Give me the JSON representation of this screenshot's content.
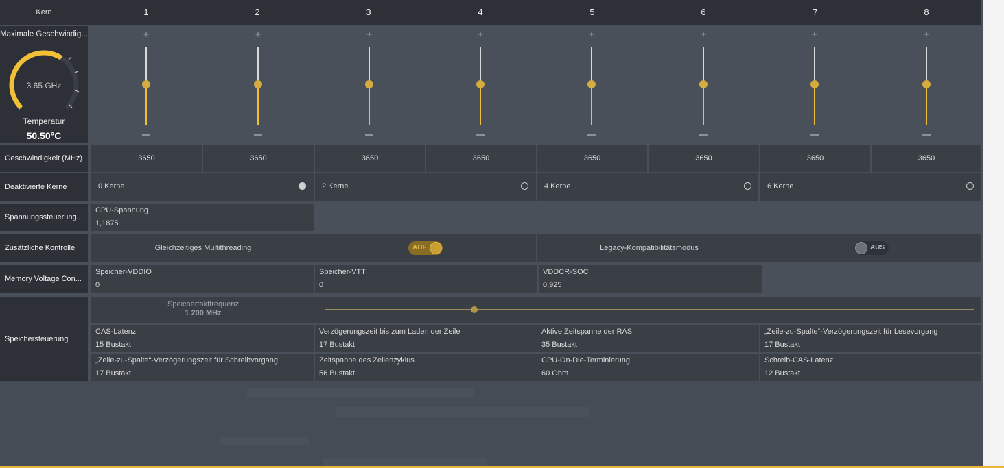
{
  "header": {
    "kern_label": "Kern",
    "cores": [
      "1",
      "2",
      "3",
      "4",
      "5",
      "6",
      "7",
      "8"
    ]
  },
  "gauge": {
    "title": "Maximale Geschwindig...",
    "value": "3.65 GHz",
    "fill_fraction": 0.62,
    "temp_label": "Temperatur",
    "temp_value": "50.50°C",
    "accent_color": "#f2c037"
  },
  "sliders": {
    "plus": "+",
    "level_fraction": 0.52
  },
  "speed": {
    "label": "Geschwindigkeit (MHz)",
    "values": [
      "3650",
      "3650",
      "3650",
      "3650",
      "3650",
      "3650",
      "3650",
      "3650"
    ]
  },
  "disabled_cores": {
    "label": "Deaktivierte Kerne",
    "options": [
      {
        "text": "0 Kerne",
        "selected": true
      },
      {
        "text": "2 Kerne",
        "selected": false
      },
      {
        "text": "4 Kerne",
        "selected": false
      },
      {
        "text": "6 Kerne",
        "selected": false
      }
    ]
  },
  "voltage": {
    "label": "Spannungssteuerung...",
    "cpu_label": "CPU-Spannung",
    "cpu_value": "1,1875"
  },
  "extra": {
    "label": "Zusätzliche Kontrolle",
    "smt_label": "Gleichzeitiges Multithreading",
    "smt_state": "AUF",
    "legacy_label": "Legacy-Kompatibilitätsmodus",
    "legacy_state": "AUS"
  },
  "memory_voltage": {
    "label": "Memory Voltage Con...",
    "items": [
      {
        "label": "Speicher-VDDIO",
        "value": "0"
      },
      {
        "label": "Speicher-VTT",
        "value": "0"
      },
      {
        "label": "VDDCR-SOC",
        "value": "0,925"
      }
    ]
  },
  "memory": {
    "label": "Speichersteuerung",
    "freq_label": "Speichertaktfrequenz",
    "freq_value": "1 200 MHz",
    "freq_fraction": 0.23,
    "timings": [
      {
        "label": "CAS-Latenz",
        "value": "15 Bustakt"
      },
      {
        "label": "Verzögerungszeit bis zum Laden der Zeile",
        "value": "17 Bustakt"
      },
      {
        "label": "Aktive Zeitspanne der RAS",
        "value": "35 Bustakt"
      },
      {
        "label": "„Zeile-zu-Spalte“-Verzögerungszeit für Lesevorgang",
        "value": "17 Bustakt"
      },
      {
        "label": "„Zeile-zu-Spalte“-Verzögerungszeit für Schreibvorgang",
        "value": "17 Bustakt"
      },
      {
        "label": "Zeitspanne des Zeilenzyklus",
        "value": "56 Bustakt"
      },
      {
        "label": "CPU-On-Die-Terminierung",
        "value": "60 Ohm"
      },
      {
        "label": "Schreib-CAS-Latenz",
        "value": "12 Bustakt"
      }
    ]
  }
}
